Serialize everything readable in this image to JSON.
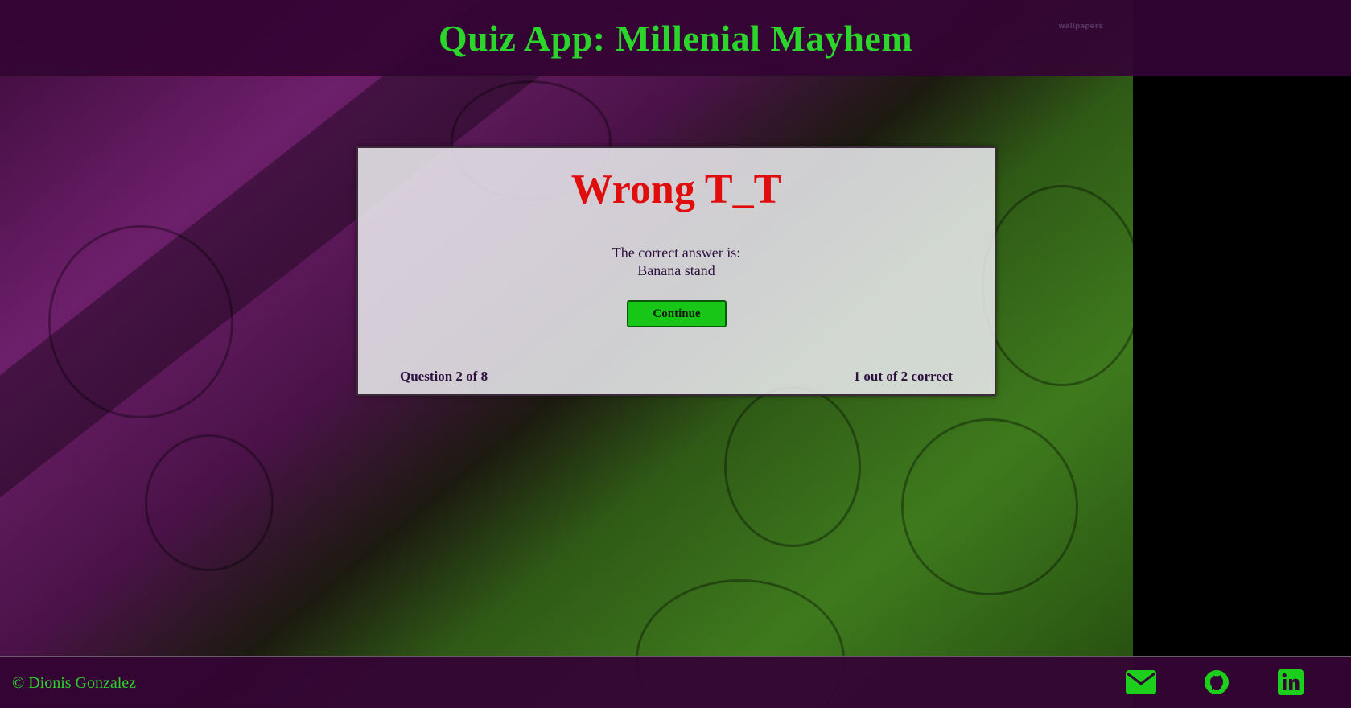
{
  "header": {
    "title": "Quiz App: Millenial Mayhem",
    "watermark": "wallpapers"
  },
  "feedback": {
    "result": "Wrong T_T",
    "answer_label": "The correct answer is:",
    "answer_value": "Banana stand",
    "continue_label": "Continue",
    "progress": "Question 2 of 8",
    "score": "1 out of 2 correct"
  },
  "footer": {
    "copyright": "© Dionis Gonzalez",
    "icons": [
      "envelope-icon",
      "github-icon",
      "linkedin-icon"
    ]
  },
  "colors": {
    "accent_green": "#2bd52b",
    "wrong_red": "#e00d0d",
    "header_purple": "#340434",
    "button_green": "#17c617"
  }
}
